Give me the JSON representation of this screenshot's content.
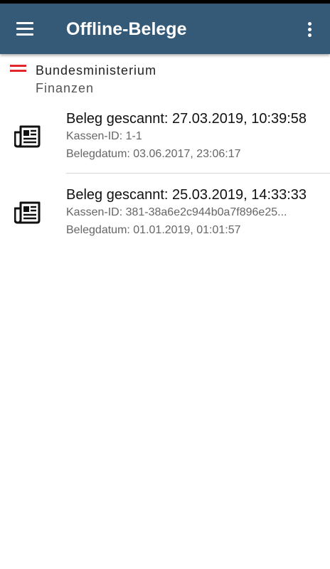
{
  "app_bar": {
    "title": "Offline-Belege",
    "menu_icon": "hamburger-menu-icon",
    "overflow_icon": "more-vertical-icon",
    "color": "#355a78"
  },
  "brand": {
    "line1": "Bundesministerium",
    "line2": "Finanzen",
    "flag_colors": [
      "#e3262c",
      "#ffffff",
      "#e3262c"
    ]
  },
  "receipts": [
    {
      "title": "Beleg gescannt: 27.03.2019, 10:39:58",
      "cash_id": "Kassen-ID: 1-1",
      "receipt_date": "Belegdatum: 03.06.2017, 23:06:17",
      "icon": "receipt-newspaper-icon"
    },
    {
      "title": "Beleg gescannt: 25.03.2019, 14:33:33",
      "cash_id": "Kassen-ID: 381-38a6e2c944b0a7f896e25...",
      "receipt_date": "Belegdatum: 01.01.2019, 01:01:57",
      "icon": "receipt-newspaper-icon"
    }
  ]
}
